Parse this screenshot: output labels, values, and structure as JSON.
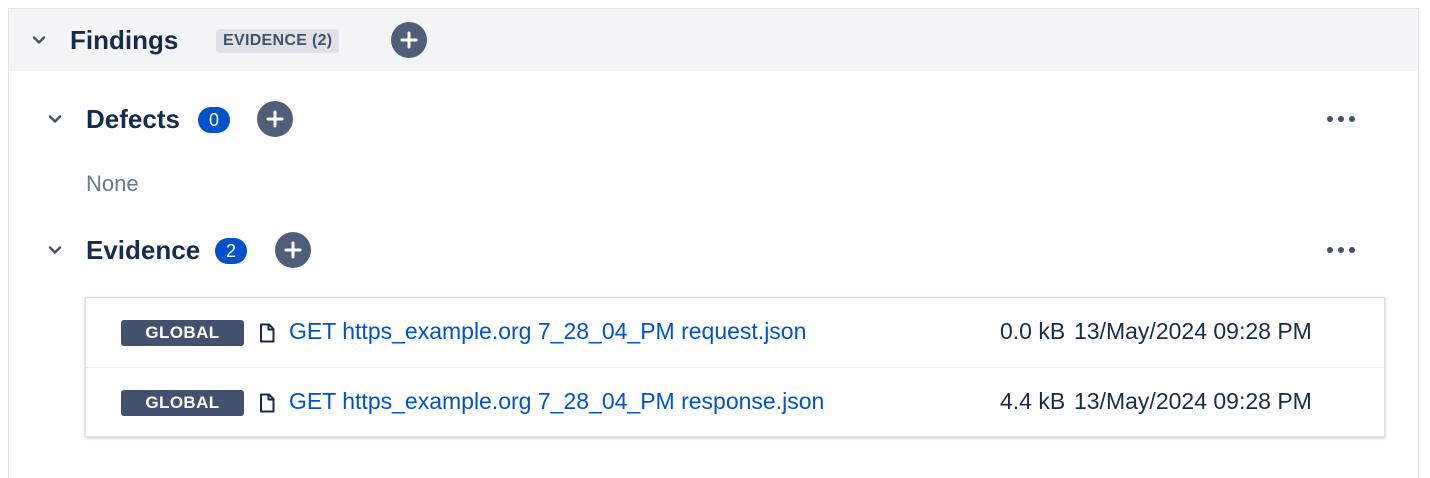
{
  "findings": {
    "title": "Findings",
    "evidence_tag": "EVIDENCE (2)"
  },
  "defects": {
    "title": "Defects",
    "count": "0",
    "empty_text": "None"
  },
  "evidence": {
    "title": "Evidence",
    "count": "2",
    "items": [
      {
        "scope": "GLOBAL",
        "filename": "GET https_example.org 7_28_04_PM request.json",
        "size": "0.0 kB",
        "date": "13/May/2024 09:28 PM"
      },
      {
        "scope": "GLOBAL",
        "filename": "GET https_example.org 7_28_04_PM response.json",
        "size": "4.4 kB",
        "date": "13/May/2024 09:28 PM"
      }
    ]
  },
  "icons": {
    "collapse": "chevron-down-icon",
    "add": "plus-icon",
    "more": "more-icon",
    "file": "file-icon"
  },
  "colors": {
    "accent": "#0052cc",
    "badge_dark": "#42526e",
    "add_button": "#505f79",
    "header_bg": "#f4f5f7"
  }
}
